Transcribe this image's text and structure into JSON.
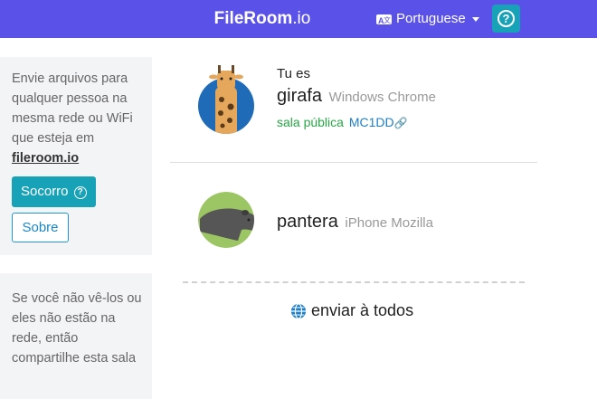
{
  "header": {
    "brand_bold": "FileRoom",
    "brand_light": ".io",
    "language": "Portuguese",
    "help_symbol": "?",
    "background_color": "#5a52e8"
  },
  "sidebar": {
    "card1": {
      "text": "Envie arquivos para qualquer pessoa na mesma rede ou WiFi que esteja em",
      "site": "fileroom.io",
      "help_button": "Socorro",
      "help_symbol": "?",
      "about_button": "Sobre"
    },
    "card2": {
      "text": "Se você não vê-los ou eles não estão na rede, então compartilhe esta sala"
    }
  },
  "me": {
    "label": "Tu es",
    "name": "girafa",
    "device": "Windows Chrome",
    "room_label": "sala pública",
    "room_code": "MC1DD",
    "avatar_icon": "giraffe-icon"
  },
  "peers": [
    {
      "name": "pantera",
      "device": "iPhone Mozilla",
      "avatar_icon": "panther-icon"
    }
  ],
  "send_all": {
    "label": "enviar à todos",
    "icon": "globe-icon"
  },
  "colors": {
    "accent": "#5a52e8",
    "teal": "#17a2b8",
    "public_green": "#28a745",
    "link_blue": "#1e7fc6"
  }
}
